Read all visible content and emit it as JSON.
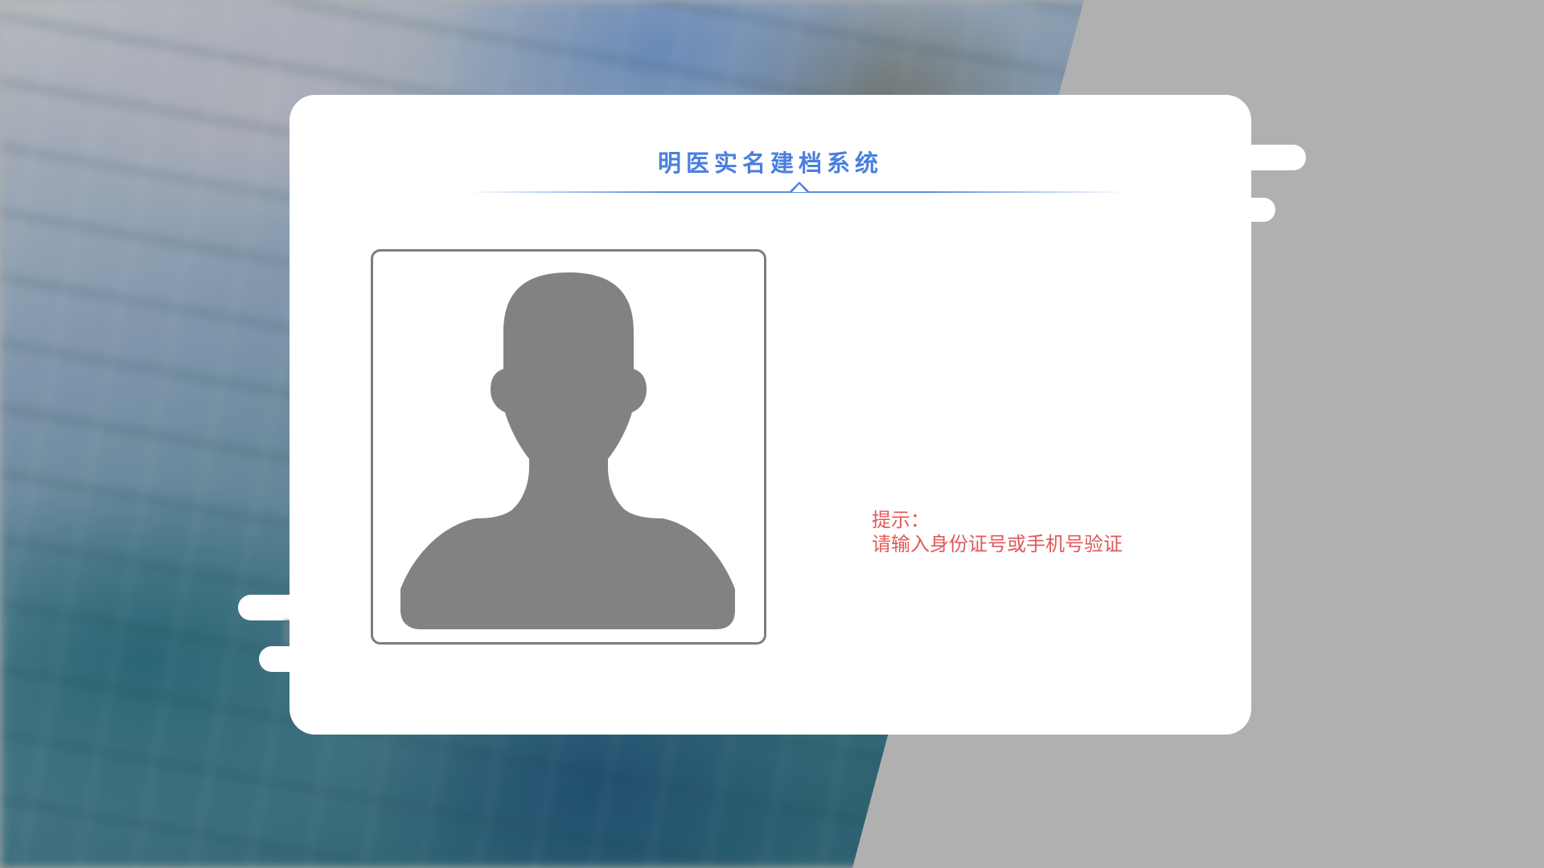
{
  "app": {
    "title": "明医实名建档系统"
  },
  "photo": {
    "icon": "person-silhouette-icon"
  },
  "hint": {
    "label": "提示：",
    "message": "请输入身份证号或手机号验证"
  },
  "colors": {
    "title": "#4a7fe0",
    "hint": "#e05a5a",
    "avatar": "#828282",
    "background": "#b0b0b0"
  }
}
